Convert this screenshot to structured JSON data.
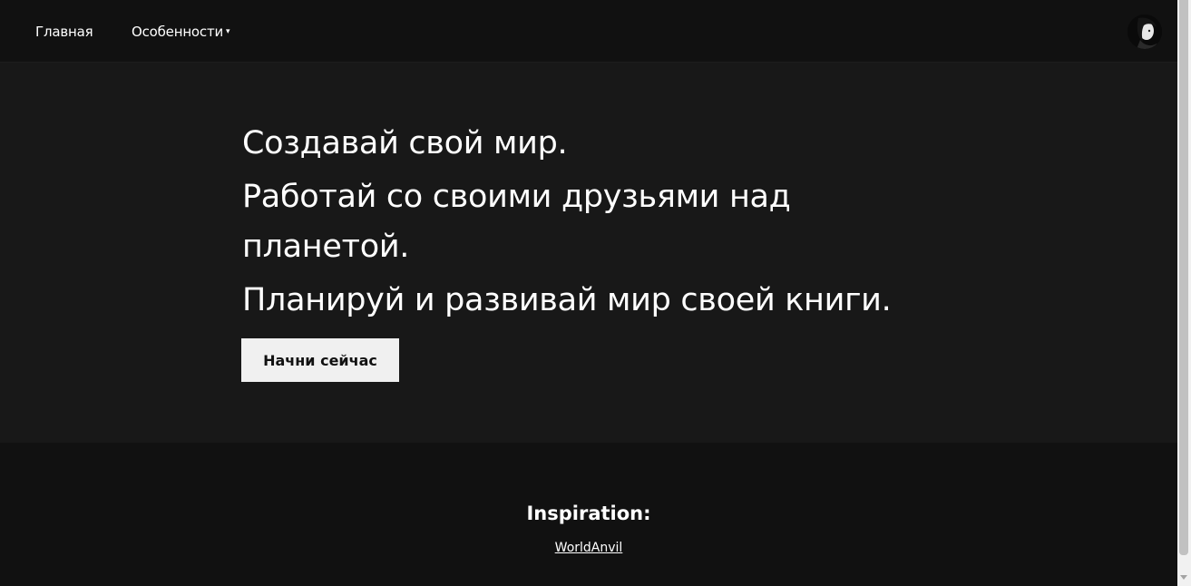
{
  "nav": {
    "home_label": "Главная",
    "features_label": "Особенности",
    "caret": "▾"
  },
  "hero": {
    "line1": "Создавай свой мир.",
    "line2": "Работай со своими друзьями над планетой.",
    "line3": "Планируй и развивай мир своей книги.",
    "cta_label": "Начни сейчас"
  },
  "footer": {
    "title": "Inspiration:",
    "link_label": "WorldAnvil"
  },
  "colors": {
    "background": "#111111",
    "hero_background": "#181818",
    "button_background": "#f0f0f0",
    "text": "#ffffff"
  },
  "icons": {
    "avatar": "user-avatar"
  }
}
